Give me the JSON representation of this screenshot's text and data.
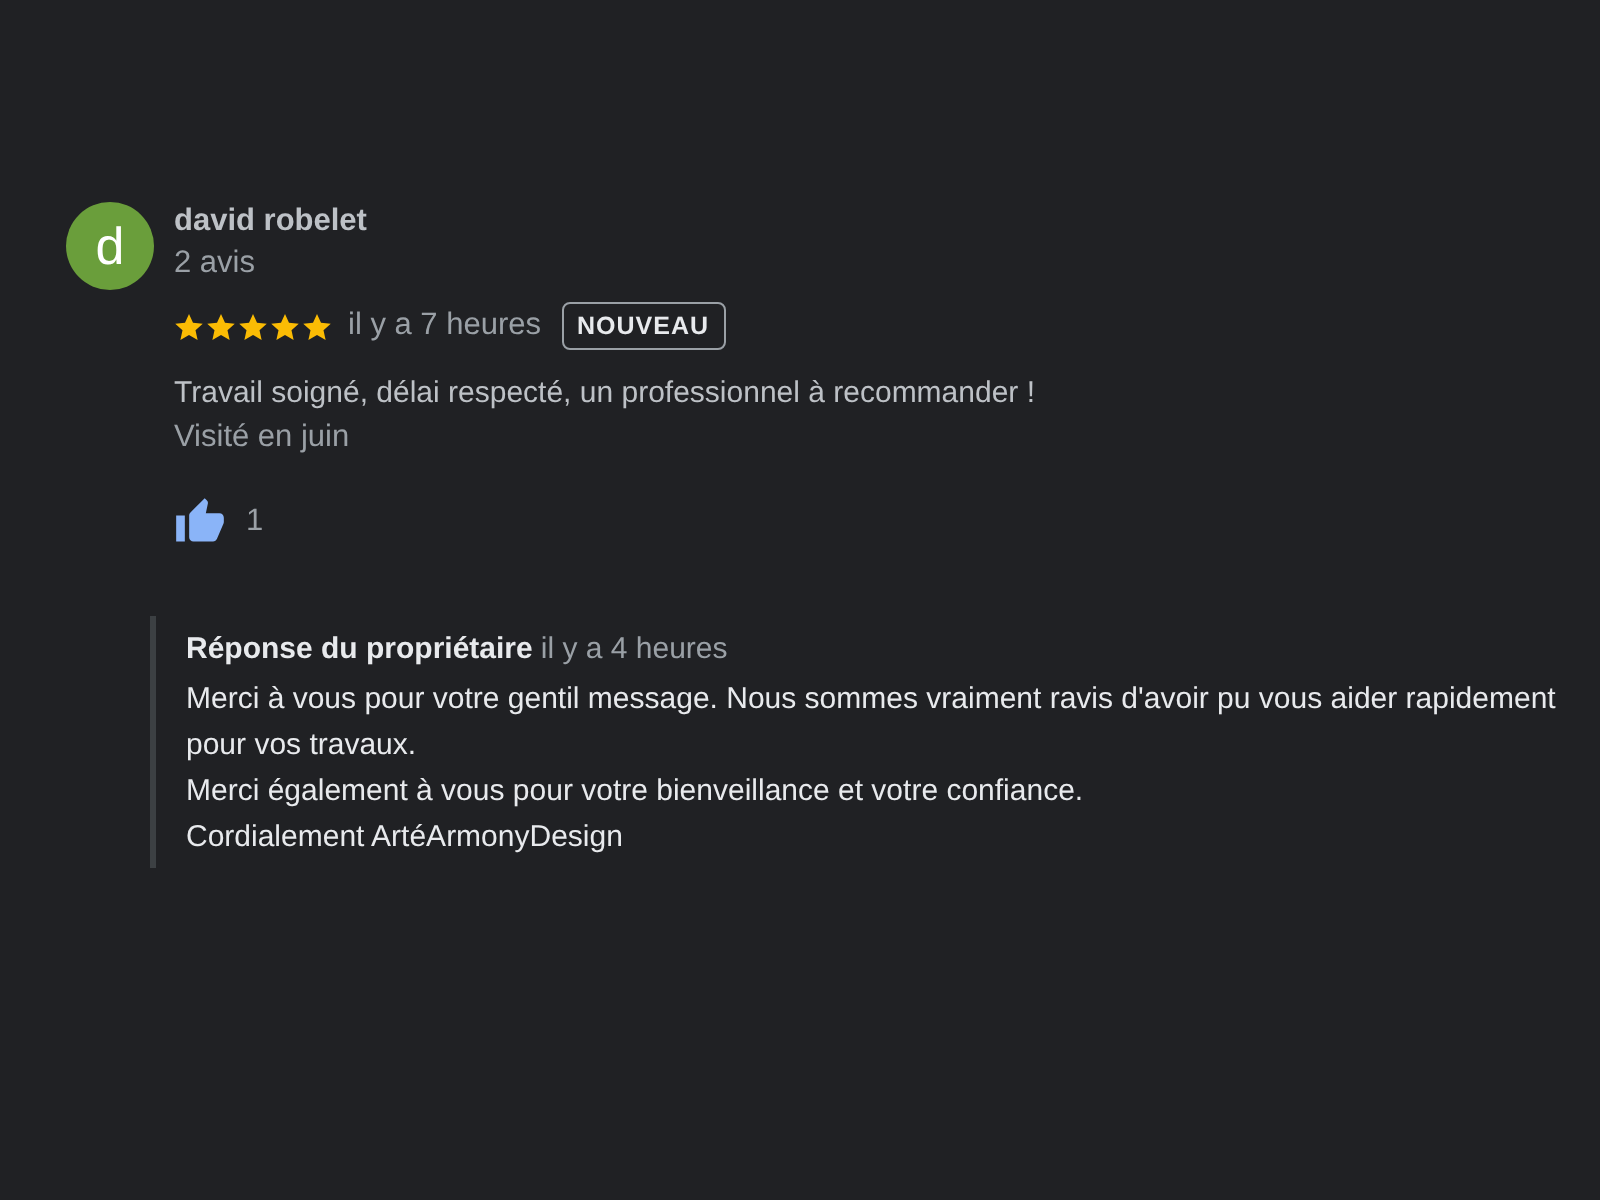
{
  "review": {
    "avatar_letter": "d",
    "author": "david robelet",
    "author_meta": "2 avis",
    "stars": 5,
    "time": "il y a 7 heures",
    "badge": "NOUVEAU",
    "text": "Travail soigné, délai respecté, un professionnel à recommander !",
    "visited": "Visité en juin",
    "likes": "1"
  },
  "owner_reply": {
    "title": "Réponse du propriétaire",
    "time": "il y a 4 heures",
    "paragraphs": [
      "Merci à vous pour votre gentil message. Nous sommes vraiment ravis d'avoir pu vous aider rapidement pour vos travaux.",
      "Merci également à vous pour votre bienveillance et votre confiance.",
      "Cordialement ArtéArmonyDesign"
    ]
  }
}
